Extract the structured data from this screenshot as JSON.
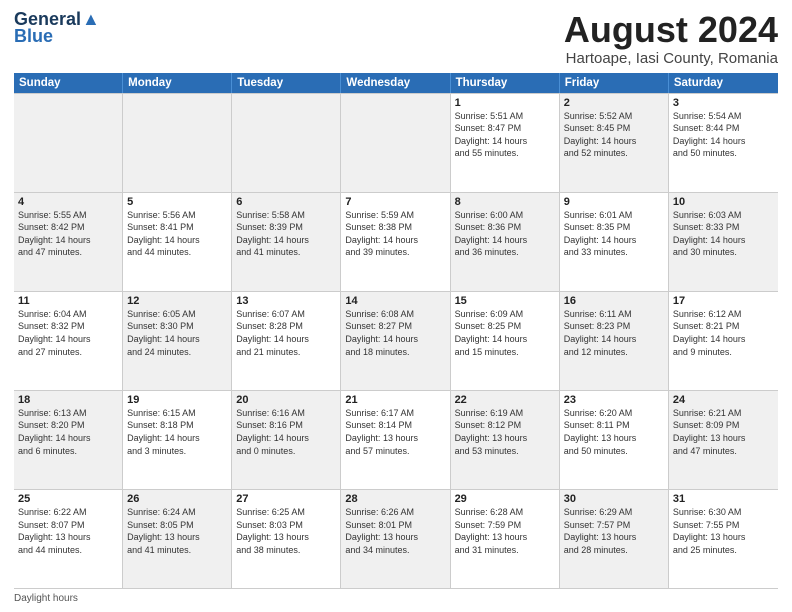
{
  "logo": {
    "line1": "General",
    "line2": "Blue"
  },
  "title": "August 2024",
  "subtitle": "Hartoape, Iasi County, Romania",
  "days_of_week": [
    "Sunday",
    "Monday",
    "Tuesday",
    "Wednesday",
    "Thursday",
    "Friday",
    "Saturday"
  ],
  "weeks": [
    [
      {
        "day": "",
        "info": "",
        "shaded": true
      },
      {
        "day": "",
        "info": "",
        "shaded": true
      },
      {
        "day": "",
        "info": "",
        "shaded": true
      },
      {
        "day": "",
        "info": "",
        "shaded": true
      },
      {
        "day": "1",
        "info": "Sunrise: 5:51 AM\nSunset: 8:47 PM\nDaylight: 14 hours\nand 55 minutes."
      },
      {
        "day": "2",
        "info": "Sunrise: 5:52 AM\nSunset: 8:45 PM\nDaylight: 14 hours\nand 52 minutes.",
        "shaded": true
      },
      {
        "day": "3",
        "info": "Sunrise: 5:54 AM\nSunset: 8:44 PM\nDaylight: 14 hours\nand 50 minutes."
      }
    ],
    [
      {
        "day": "4",
        "info": "Sunrise: 5:55 AM\nSunset: 8:42 PM\nDaylight: 14 hours\nand 47 minutes.",
        "shaded": true
      },
      {
        "day": "5",
        "info": "Sunrise: 5:56 AM\nSunset: 8:41 PM\nDaylight: 14 hours\nand 44 minutes."
      },
      {
        "day": "6",
        "info": "Sunrise: 5:58 AM\nSunset: 8:39 PM\nDaylight: 14 hours\nand 41 minutes.",
        "shaded": true
      },
      {
        "day": "7",
        "info": "Sunrise: 5:59 AM\nSunset: 8:38 PM\nDaylight: 14 hours\nand 39 minutes."
      },
      {
        "day": "8",
        "info": "Sunrise: 6:00 AM\nSunset: 8:36 PM\nDaylight: 14 hours\nand 36 minutes.",
        "shaded": true
      },
      {
        "day": "9",
        "info": "Sunrise: 6:01 AM\nSunset: 8:35 PM\nDaylight: 14 hours\nand 33 minutes."
      },
      {
        "day": "10",
        "info": "Sunrise: 6:03 AM\nSunset: 8:33 PM\nDaylight: 14 hours\nand 30 minutes.",
        "shaded": true
      }
    ],
    [
      {
        "day": "11",
        "info": "Sunrise: 6:04 AM\nSunset: 8:32 PM\nDaylight: 14 hours\nand 27 minutes."
      },
      {
        "day": "12",
        "info": "Sunrise: 6:05 AM\nSunset: 8:30 PM\nDaylight: 14 hours\nand 24 minutes.",
        "shaded": true
      },
      {
        "day": "13",
        "info": "Sunrise: 6:07 AM\nSunset: 8:28 PM\nDaylight: 14 hours\nand 21 minutes."
      },
      {
        "day": "14",
        "info": "Sunrise: 6:08 AM\nSunset: 8:27 PM\nDaylight: 14 hours\nand 18 minutes.",
        "shaded": true
      },
      {
        "day": "15",
        "info": "Sunrise: 6:09 AM\nSunset: 8:25 PM\nDaylight: 14 hours\nand 15 minutes."
      },
      {
        "day": "16",
        "info": "Sunrise: 6:11 AM\nSunset: 8:23 PM\nDaylight: 14 hours\nand 12 minutes.",
        "shaded": true
      },
      {
        "day": "17",
        "info": "Sunrise: 6:12 AM\nSunset: 8:21 PM\nDaylight: 14 hours\nand 9 minutes."
      }
    ],
    [
      {
        "day": "18",
        "info": "Sunrise: 6:13 AM\nSunset: 8:20 PM\nDaylight: 14 hours\nand 6 minutes.",
        "shaded": true
      },
      {
        "day": "19",
        "info": "Sunrise: 6:15 AM\nSunset: 8:18 PM\nDaylight: 14 hours\nand 3 minutes."
      },
      {
        "day": "20",
        "info": "Sunrise: 6:16 AM\nSunset: 8:16 PM\nDaylight: 14 hours\nand 0 minutes.",
        "shaded": true
      },
      {
        "day": "21",
        "info": "Sunrise: 6:17 AM\nSunset: 8:14 PM\nDaylight: 13 hours\nand 57 minutes."
      },
      {
        "day": "22",
        "info": "Sunrise: 6:19 AM\nSunset: 8:12 PM\nDaylight: 13 hours\nand 53 minutes.",
        "shaded": true
      },
      {
        "day": "23",
        "info": "Sunrise: 6:20 AM\nSunset: 8:11 PM\nDaylight: 13 hours\nand 50 minutes."
      },
      {
        "day": "24",
        "info": "Sunrise: 6:21 AM\nSunset: 8:09 PM\nDaylight: 13 hours\nand 47 minutes.",
        "shaded": true
      }
    ],
    [
      {
        "day": "25",
        "info": "Sunrise: 6:22 AM\nSunset: 8:07 PM\nDaylight: 13 hours\nand 44 minutes."
      },
      {
        "day": "26",
        "info": "Sunrise: 6:24 AM\nSunset: 8:05 PM\nDaylight: 13 hours\nand 41 minutes.",
        "shaded": true
      },
      {
        "day": "27",
        "info": "Sunrise: 6:25 AM\nSunset: 8:03 PM\nDaylight: 13 hours\nand 38 minutes."
      },
      {
        "day": "28",
        "info": "Sunrise: 6:26 AM\nSunset: 8:01 PM\nDaylight: 13 hours\nand 34 minutes.",
        "shaded": true
      },
      {
        "day": "29",
        "info": "Sunrise: 6:28 AM\nSunset: 7:59 PM\nDaylight: 13 hours\nand 31 minutes."
      },
      {
        "day": "30",
        "info": "Sunrise: 6:29 AM\nSunset: 7:57 PM\nDaylight: 13 hours\nand 28 minutes.",
        "shaded": true
      },
      {
        "day": "31",
        "info": "Sunrise: 6:30 AM\nSunset: 7:55 PM\nDaylight: 13 hours\nand 25 minutes."
      }
    ]
  ],
  "footer": "Daylight hours"
}
